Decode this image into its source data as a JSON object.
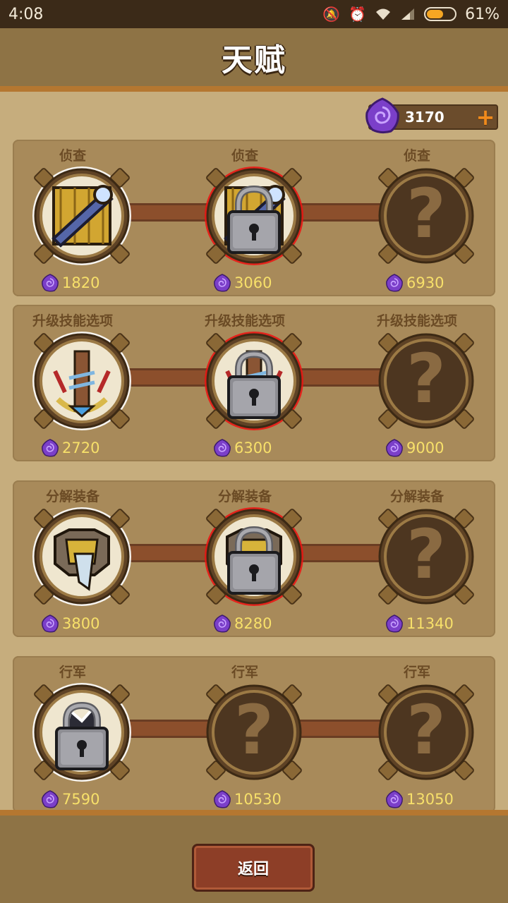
{
  "status_bar": {
    "time": "4:08",
    "battery": "61%",
    "battery_level": 0.61
  },
  "header": {
    "title": "天赋"
  },
  "currency": {
    "value": "3170",
    "add_label": "+"
  },
  "rows": [
    {
      "nodes": [
        {
          "label": "侦查",
          "cost": "1820",
          "state": "unlocked",
          "icon": "spyglass-icon"
        },
        {
          "label": "侦查",
          "cost": "3060",
          "state": "locked",
          "icon": "spyglass-icon"
        },
        {
          "label": "侦查",
          "cost": "6930",
          "state": "unknown",
          "icon": "question-icon"
        }
      ]
    },
    {
      "nodes": [
        {
          "label": "升级技能选项",
          "cost": "2720",
          "state": "unlocked",
          "icon": "totem-icon"
        },
        {
          "label": "升级技能选项",
          "cost": "6300",
          "state": "locked",
          "icon": "totem-icon"
        },
        {
          "label": "升级技能选项",
          "cost": "9000",
          "state": "unknown",
          "icon": "question-icon"
        }
      ]
    },
    {
      "nodes": [
        {
          "label": "分解装备",
          "cost": "3800",
          "state": "unlocked",
          "icon": "anvil-icon"
        },
        {
          "label": "分解装备",
          "cost": "8280",
          "state": "locked",
          "icon": "anvil-icon"
        },
        {
          "label": "分解装备",
          "cost": "11340",
          "state": "unknown",
          "icon": "question-icon"
        }
      ]
    },
    {
      "nodes": [
        {
          "label": "行军",
          "cost": "7590",
          "state": "locked-glow",
          "icon": "boot-icon"
        },
        {
          "label": "行军",
          "cost": "10530",
          "state": "unknown",
          "icon": "question-icon"
        },
        {
          "label": "行军",
          "cost": "13050",
          "state": "unknown",
          "icon": "question-icon"
        }
      ]
    }
  ],
  "footer": {
    "back_label": "返回"
  }
}
